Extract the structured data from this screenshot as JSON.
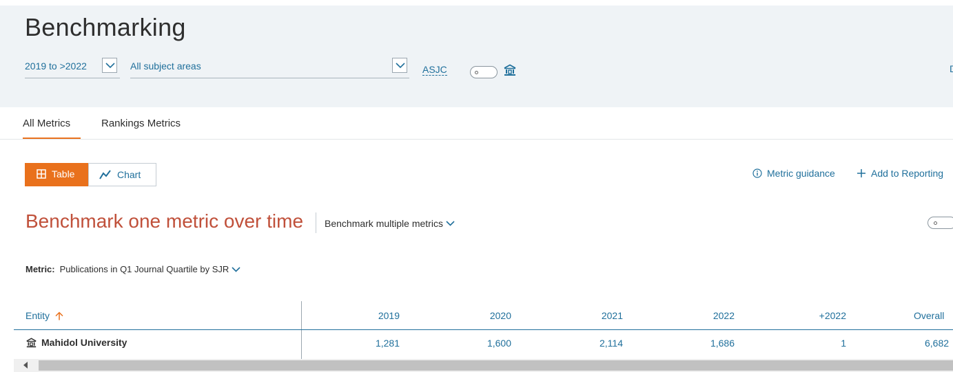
{
  "header": {
    "title": "Benchmarking",
    "year_range": "2019 to >2022",
    "subject_area": "All subject areas",
    "classification": "ASJC",
    "edge_text": "D"
  },
  "tabs": [
    {
      "label": "All Metrics",
      "active": true
    },
    {
      "label": "Rankings Metrics",
      "active": false
    }
  ],
  "view": {
    "table_label": "Table",
    "chart_label": "Chart",
    "metric_guidance": "Metric guidance",
    "add_to_reporting": "Add to Reporting"
  },
  "benchmark": {
    "title": "Benchmark one metric over time",
    "alternative": "Benchmark multiple metrics"
  },
  "metric": {
    "label": "Metric:",
    "value": "Publications in Q1 Journal Quartile by SJR"
  },
  "table": {
    "columns": [
      "Entity",
      "2019",
      "2020",
      "2021",
      "2022",
      "+2022",
      "Overall"
    ],
    "sort_indicator": "ascending",
    "rows": [
      {
        "entity": "Mahidol University",
        "values": [
          "1,281",
          "1,600",
          "2,114",
          "1,686",
          "1",
          "6,682"
        ]
      }
    ]
  },
  "colors": {
    "accent": "#e9711c",
    "link": "#1f6f9b",
    "heading": "#c0503a",
    "header_bg": "#eff3f6"
  }
}
